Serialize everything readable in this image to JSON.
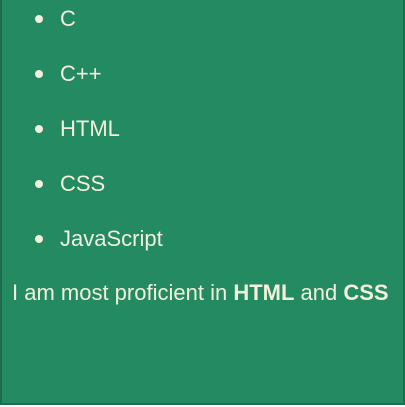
{
  "skills": {
    "items": [
      {
        "label": "C"
      },
      {
        "label": "C++"
      },
      {
        "label": "HTML"
      },
      {
        "label": "CSS"
      },
      {
        "label": "JavaScript"
      }
    ]
  },
  "summary": {
    "text_before": "I am most proficient in",
    "highlight_1": "HTML",
    "text_middle": "and",
    "highlight_2": "CSS"
  },
  "theme": {
    "background": "#238a62",
    "text": "#f2efdc",
    "border": "#1e6d51"
  }
}
